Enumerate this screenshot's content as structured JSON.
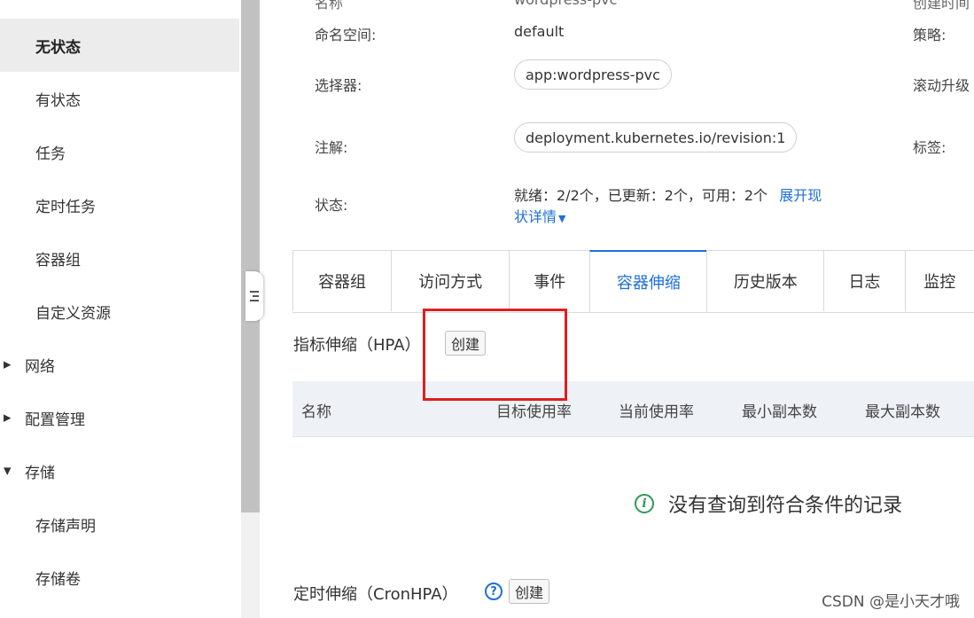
{
  "sidebar": {
    "items": [
      {
        "label": "无状态",
        "type": "sub",
        "active": true
      },
      {
        "label": "有状态",
        "type": "sub"
      },
      {
        "label": "任务",
        "type": "sub"
      },
      {
        "label": "定时任务",
        "type": "sub"
      },
      {
        "label": "容器组",
        "type": "sub"
      },
      {
        "label": "自定义资源",
        "type": "sub"
      },
      {
        "label": "网络",
        "type": "group",
        "caret": "caret-right"
      },
      {
        "label": "配置管理",
        "type": "group",
        "caret": "caret-right"
      },
      {
        "label": "存储",
        "type": "group",
        "caret": "caret-down"
      },
      {
        "label": "存储声明",
        "type": "sub"
      },
      {
        "label": "存储卷",
        "type": "sub"
      }
    ]
  },
  "detail": {
    "top_left_clipped": "名称",
    "top_mid_clipped": "wordpress-pvc",
    "top_right_clipped": "创建时间",
    "namespace_label": "命名空间:",
    "namespace_value": "default",
    "selector_label": "选择器:",
    "selector_value": "app:wordpress-pvc",
    "annotation_label": "注解:",
    "annotation_value": "deployment.kubernetes.io/revision:1",
    "status_label": "状态:",
    "status_value": "就绪：2/2个，已更新：2个，可用：2个",
    "status_link_1": "展开现",
    "status_link_2": "状详情",
    "strategy_label": "策略:",
    "rolling_label": "滚动升级",
    "tags_label": "标签:"
  },
  "tabs": [
    {
      "label": "容器组"
    },
    {
      "label": "访问方式"
    },
    {
      "label": "事件"
    },
    {
      "label": "容器伸缩",
      "active": true
    },
    {
      "label": "历史版本"
    },
    {
      "label": "日志"
    },
    {
      "label": "监控"
    }
  ],
  "hpa": {
    "title": "指标伸缩（HPA）",
    "create_label": "创建",
    "columns": [
      "名称",
      "目标使用率",
      "当前使用率",
      "最小副本数",
      "最大副本数"
    ],
    "empty_text": "没有查询到符合条件的记录"
  },
  "cronhpa": {
    "title": "定时伸缩（CronHPA）",
    "help_icon": "?",
    "create_label": "创建"
  },
  "watermark": "CSDN @是小天才哦",
  "colors": {
    "accent": "#1e6fd9",
    "highlight": "#e01e1e",
    "success": "#2f9a55"
  }
}
